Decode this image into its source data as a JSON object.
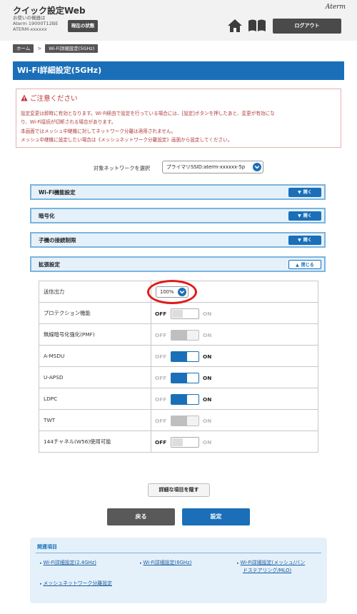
{
  "header": {
    "app_title": "クイック設定Web",
    "device_caption": "お使いの機器は",
    "device_model": "Aterm 19000T12BE",
    "device_name": "ATERM-xxxxxx",
    "status_button": "現在の状態",
    "logo": "Aterm",
    "logout_button": "ログアウト"
  },
  "breadcrumb": {
    "home": "ホーム",
    "separator": ">",
    "current": "Wi-Fi詳細設定(5GHz)"
  },
  "page_title": "Wi-Fi詳細設定(5GHz)",
  "caution": {
    "title": "ご注意ください",
    "lines": [
      "設定変更は即時に有効となります。Wi-Fi経由で設定を行っている場合には、[設定]ボタンを押したあと、変更が有効にな",
      "り、Wi-Fi接続が切断される場合があります。",
      "本画面ではメッシュ中継機に対してネットワーク分離は適用されません。",
      "メッシュ中継機に設定したい場合は《メッシュネットワーク分離設定》画面から設定してください。"
    ]
  },
  "network_select": {
    "label": "対象ネットワークを選択",
    "value": "プライマリSSID:aterm-xxxxxx-5p"
  },
  "sections": [
    {
      "label": "Wi-Fi機能設定",
      "button": "開く",
      "state": "collapsed"
    },
    {
      "label": "暗号化",
      "button": "開く",
      "state": "collapsed"
    },
    {
      "label": "子機の接続制限",
      "button": "開く",
      "state": "collapsed"
    },
    {
      "label": "拡張設定",
      "button": "閉じる",
      "state": "expanded"
    }
  ],
  "settings": [
    {
      "label": "送信出力",
      "type": "select",
      "value": "100%"
    },
    {
      "label": "プロテクション機能",
      "type": "switch",
      "state": "off",
      "off": "OFF",
      "on": "ON"
    },
    {
      "label": "無線暗号化強化(PMF)",
      "type": "switch",
      "state": "disabled-on",
      "off": "OFF",
      "on": "ON"
    },
    {
      "label": "A-MSDU",
      "type": "switch",
      "state": "on",
      "off": "OFF",
      "on": "ON"
    },
    {
      "label": "U-APSD",
      "type": "switch",
      "state": "on",
      "off": "OFF",
      "on": "ON"
    },
    {
      "label": "LDPC",
      "type": "switch",
      "state": "on",
      "off": "OFF",
      "on": "ON"
    },
    {
      "label": "TWT",
      "type": "switch",
      "state": "disabled-on",
      "off": "OFF",
      "on": "ON"
    },
    {
      "label": "144チャネル(W56)使用可能",
      "type": "switch",
      "state": "off",
      "off": "OFF",
      "on": "ON"
    }
  ],
  "buttons": {
    "hide_details": "詳細な項目を隠す",
    "back": "戻る",
    "apply": "設定"
  },
  "related": {
    "title": "関連項目",
    "links": [
      "Wi-Fi詳細設定(2.4GHz)",
      "Wi-Fi詳細設定(6GHz)",
      "Wi-Fi詳細設定(メッシュ/バン",
      "ドステアリング/MLO)",
      "メッシュネットワーク分離設定"
    ]
  },
  "colors": {
    "primary": "#1a6fb8",
    "section_bg": "#e4f1fb",
    "caution_text": "#b03a3a",
    "highlight_ring": "#e01a1a"
  },
  "icons": {
    "home": "home-icon",
    "manual": "book-icon",
    "warning": "warning-icon",
    "chevron": "chevron-down-icon"
  }
}
